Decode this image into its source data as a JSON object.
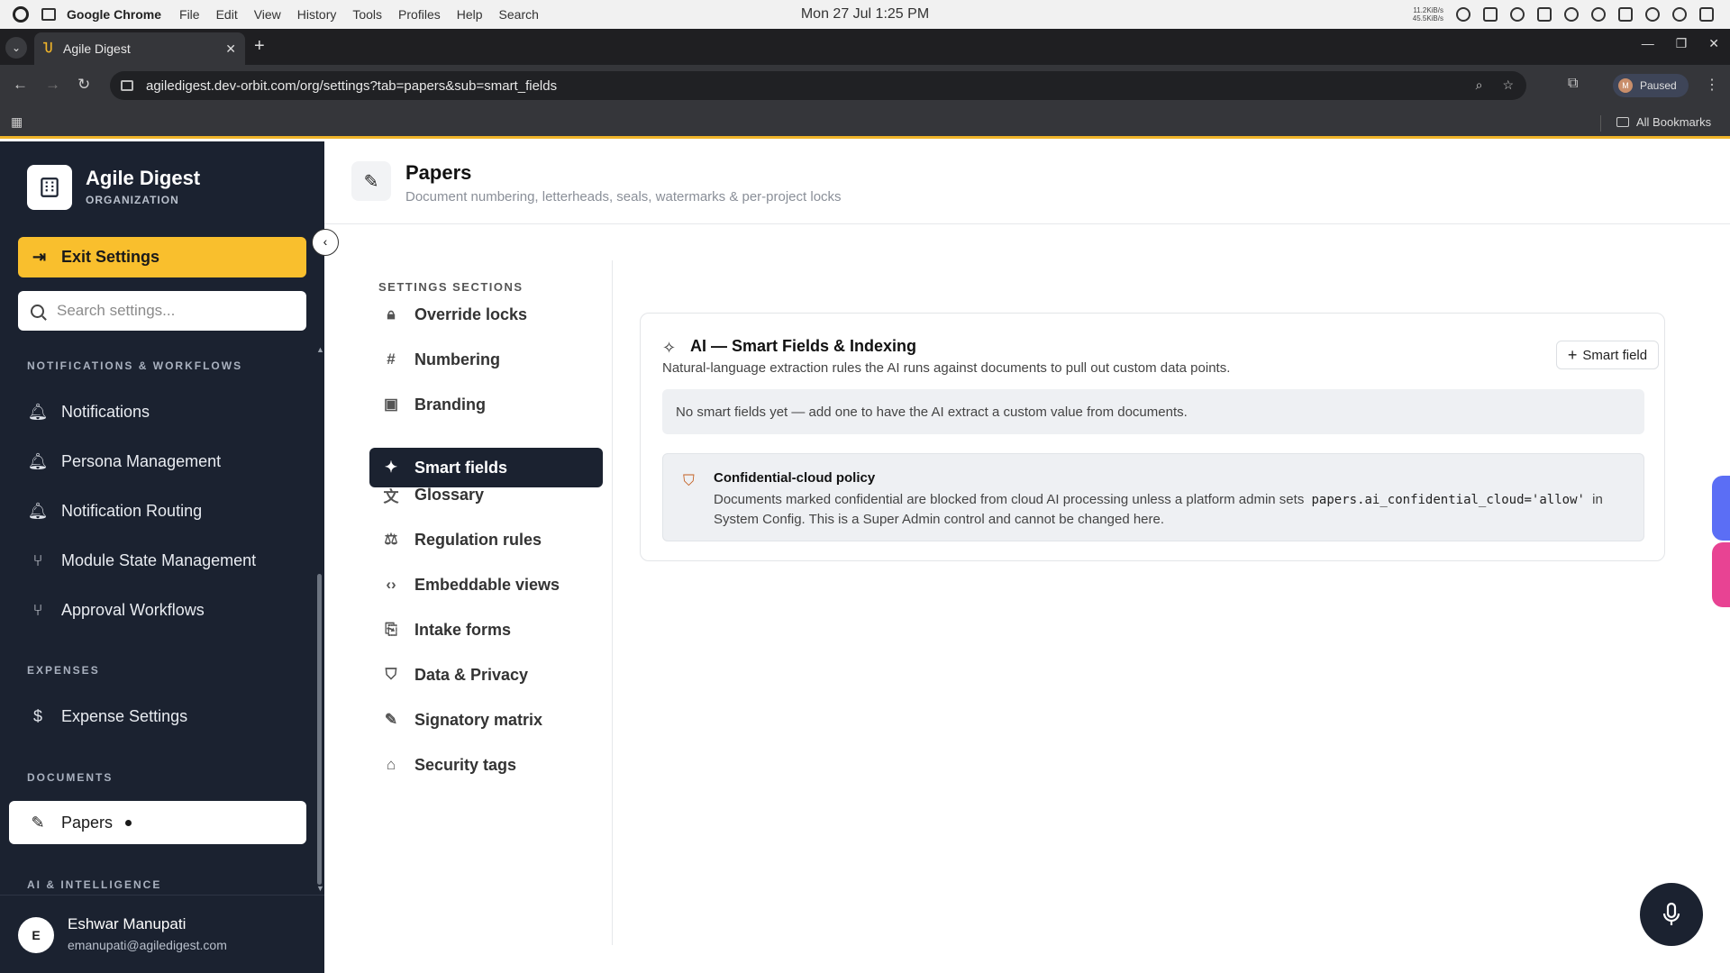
{
  "os": {
    "app_name": "Google Chrome",
    "menus": [
      "File",
      "Edit",
      "View",
      "History",
      "Tools",
      "Profiles",
      "Help",
      "Search"
    ],
    "clock": "Mon 27 Jul  1:25 PM",
    "net_up": "11.2KiB/s",
    "net_down": "45.5KiB/s"
  },
  "browser": {
    "tab_title": "Agile Digest",
    "url": "agiledigest.dev-orbit.com/org/settings?tab=papers&sub=smart_fields",
    "profile_initial": "M",
    "profile_status": "Paused",
    "bookmarks_label": "All Bookmarks"
  },
  "sidebar": {
    "org_name": "Agile Digest",
    "org_type": "ORGANIZATION",
    "exit_label": "Exit Settings",
    "search_placeholder": "Search settings...",
    "sections": {
      "notifications": "NOTIFICATIONS & WORKFLOWS",
      "expenses": "EXPENSES",
      "documents": "DOCUMENTS",
      "ai": "AI & INTELLIGENCE"
    },
    "items": [
      {
        "label": "Notifications",
        "icon": "bell-icon"
      },
      {
        "label": "Persona Management",
        "icon": "bell-ring-icon"
      },
      {
        "label": "Notification Routing",
        "icon": "bell-ring-icon"
      },
      {
        "label": "Module State Management",
        "icon": "git-branch-icon"
      },
      {
        "label": "Approval Workflows",
        "icon": "git-branch-icon"
      },
      {
        "label": "Expense Settings",
        "icon": "receipt-icon"
      },
      {
        "label": "Papers",
        "icon": "edit-document-icon",
        "active": true
      }
    ],
    "user": {
      "initial": "E",
      "name": "Eshwar Manupati",
      "email": "emanupati@agiledigest.com"
    }
  },
  "header": {
    "title": "Papers",
    "subtitle": "Document numbering, letterheads, seals, watermarks & per-project locks"
  },
  "sections_nav": {
    "label": "SETTINGS SECTIONS",
    "items": [
      {
        "label": "Override locks",
        "icon": "lock-icon"
      },
      {
        "label": "Numbering",
        "icon": "hash-icon"
      },
      {
        "label": "Branding",
        "icon": "image-icon"
      },
      {
        "label": "Smart fields",
        "icon": "sparkles-icon",
        "active": true
      },
      {
        "label": "Glossary",
        "icon": "translate-icon"
      },
      {
        "label": "Regulation rules",
        "icon": "scale-icon"
      },
      {
        "label": "Embeddable views",
        "icon": "code-icon"
      },
      {
        "label": "Intake forms",
        "icon": "file-import-icon"
      },
      {
        "label": "Data & Privacy",
        "icon": "shield-check-icon"
      },
      {
        "label": "Signatory matrix",
        "icon": "pen-icon"
      },
      {
        "label": "Security tags",
        "icon": "tag-icon"
      }
    ]
  },
  "card": {
    "title": "AI — Smart Fields & Indexing",
    "subtitle": "Natural-language extraction rules the AI runs against documents to pull out custom data points.",
    "add_label": "Smart field",
    "empty_text": "No smart fields yet — add one to have the AI extract a custom value from documents.",
    "policy": {
      "title": "Confidential-cloud policy",
      "body_before": "Documents marked confidential are blocked from cloud AI processing unless a platform admin sets",
      "code": "papers.ai_confidential_cloud='allow'",
      "body_after": "in System Config. This is a Super Admin control and cannot be changed here."
    }
  },
  "colors": {
    "sidebar_bg": "#1b2230",
    "accent": "#f9bf2d",
    "policy_icon": "#c25c1c"
  }
}
